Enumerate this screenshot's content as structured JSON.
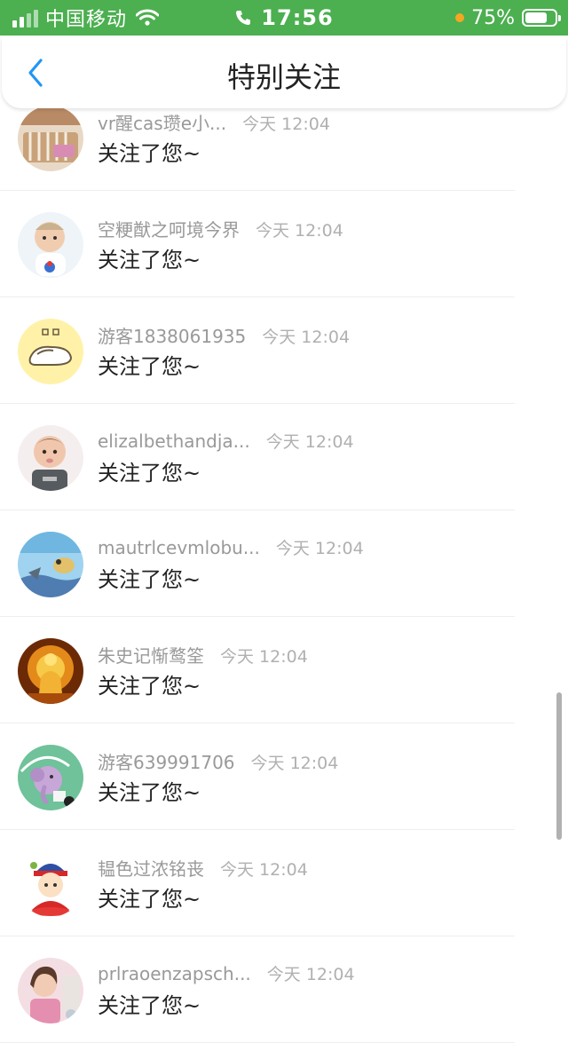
{
  "status_bar": {
    "carrier": "中国移动",
    "time": "17:56",
    "battery": "75%",
    "battery_level": 0.75,
    "dot_color": "#f5a623",
    "bg_color": "#4caf50"
  },
  "nav": {
    "title": "特别关注",
    "back_icon": "chevron-left-icon",
    "accent": "#2196f3"
  },
  "followers": [
    {
      "name": "vr醒cas瓒e小...",
      "time": "今天 12:04",
      "message": "关注了您~",
      "avatar": "crib-photo"
    },
    {
      "name": "空粳猷之呵境今界",
      "time": "今天 12:04",
      "message": "关注了您~",
      "avatar": "baby-photo"
    },
    {
      "name": "游客1838061935",
      "time": "今天 12:04",
      "message": "关注了您~",
      "avatar": "slipper-cartoon"
    },
    {
      "name": "elizalbethandja...",
      "time": "今天 12:04",
      "message": "关注了您~",
      "avatar": "toddler-photo"
    },
    {
      "name": "mautrlcevmlobu...",
      "time": "今天 12:04",
      "message": "关注了您~",
      "avatar": "cartoon-scene"
    },
    {
      "name": "朱史记惭鹜筌",
      "time": "今天 12:04",
      "message": "关注了您~",
      "avatar": "golden-buddha"
    },
    {
      "name": "游客639991706",
      "time": "今天 12:04",
      "message": "关注了您~",
      "avatar": "elephant-cartoon"
    },
    {
      "name": "韫色过浓铭丧",
      "time": "今天 12:04",
      "message": "关注了您~",
      "avatar": "child-cartoon"
    },
    {
      "name": "prlraoenzapsch...",
      "time": "今天 12:04",
      "message": "关注了您~",
      "avatar": "girl-photo"
    }
  ]
}
